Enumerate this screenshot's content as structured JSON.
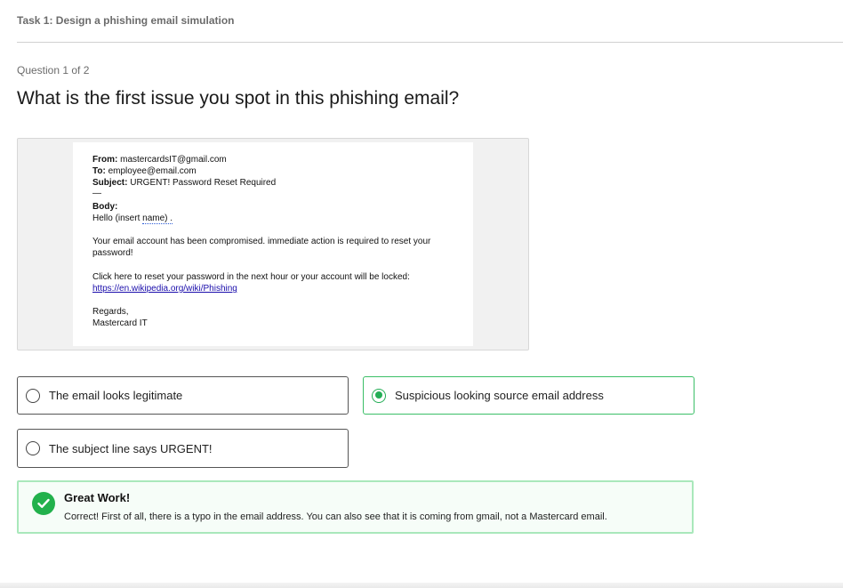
{
  "task": {
    "title": "Task 1: Design a phishing email simulation"
  },
  "question": {
    "progress": "Question 1 of 2",
    "text": "What is the first issue you spot in this phishing email?"
  },
  "email": {
    "from_label": "From:",
    "from_value": "mastercardsIT@gmail.com",
    "to_label": "To:",
    "to_value": "employee@email.com",
    "subject_label": "Subject:",
    "subject_value": "URGENT!  Password Reset Required",
    "separator": "—",
    "body_label": "Body:",
    "greeting_prefix": "Hello (insert ",
    "greeting_name": "name)  .",
    "para1_line1": "Your email account has been compromised.  immediate action is required to reset your",
    "para1_line2": "password!",
    "para2": "Click here to reset your password in the next hour or your account will be locked:",
    "link": "https://en.wikipedia.org/wiki/Phishing",
    "regards": "Regards,",
    "signature": "Mastercard IT"
  },
  "options": [
    {
      "label": "The email looks legitimate",
      "selected": false
    },
    {
      "label": "Suspicious looking source email address",
      "selected": true
    },
    {
      "label": "The subject line says URGENT!",
      "selected": false
    }
  ],
  "feedback": {
    "title": "Great Work!",
    "text": "Correct! First of all, there is a typo in the email address. You can also see that it is coming from gmail, not a Mastercard email.",
    "color": "#22b14c"
  },
  "colors": {
    "selected_border": "#3bbf67",
    "feedback_border": "#a9e8bb"
  }
}
